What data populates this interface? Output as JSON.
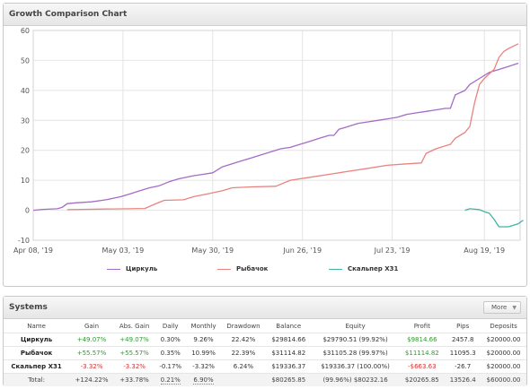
{
  "chart_panel": {
    "title": "Growth Comparison Chart"
  },
  "chart_data": {
    "type": "line",
    "x_ticks": [
      "Apr 08, '19",
      "May 03, '19",
      "May 30, '19",
      "Jun 26, '19",
      "Jul 23, '19",
      "Aug 19, '19"
    ],
    "y_ticks": [
      "60",
      "50",
      "40",
      "30",
      "20",
      "10",
      "0",
      "-10"
    ],
    "ylim": [
      -10,
      60
    ],
    "series": [
      {
        "name": "Циркуль",
        "color": "#a56bc6",
        "points": [
          [
            0,
            0
          ],
          [
            0.02,
            0.3
          ],
          [
            0.05,
            0.5
          ],
          [
            0.06,
            1.0
          ],
          [
            0.07,
            2.2
          ],
          [
            0.09,
            2.5
          ],
          [
            0.12,
            2.8
          ],
          [
            0.15,
            3.5
          ],
          [
            0.18,
            4.5
          ],
          [
            0.2,
            5.5
          ],
          [
            0.22,
            6.5
          ],
          [
            0.24,
            7.5
          ],
          [
            0.26,
            8.2
          ],
          [
            0.28,
            9.5
          ],
          [
            0.3,
            10.5
          ],
          [
            0.33,
            11.5
          ],
          [
            0.35,
            12
          ],
          [
            0.37,
            12.5
          ],
          [
            0.39,
            14.5
          ],
          [
            0.41,
            15.5
          ],
          [
            0.43,
            16.5
          ],
          [
            0.45,
            17.5
          ],
          [
            0.47,
            18.5
          ],
          [
            0.49,
            19.5
          ],
          [
            0.51,
            20.5
          ],
          [
            0.53,
            21
          ],
          [
            0.55,
            22
          ],
          [
            0.57,
            23
          ],
          [
            0.59,
            24
          ],
          [
            0.61,
            25
          ],
          [
            0.62,
            25
          ],
          [
            0.63,
            27
          ],
          [
            0.65,
            28
          ],
          [
            0.67,
            29
          ],
          [
            0.69,
            29.5
          ],
          [
            0.71,
            30
          ],
          [
            0.73,
            30.5
          ],
          [
            0.75,
            31
          ],
          [
            0.77,
            32
          ],
          [
            0.79,
            32.5
          ],
          [
            0.81,
            33
          ],
          [
            0.83,
            33.5
          ],
          [
            0.85,
            34
          ],
          [
            0.86,
            34
          ],
          [
            0.87,
            38.5
          ],
          [
            0.89,
            40
          ],
          [
            0.9,
            42
          ],
          [
            0.92,
            44
          ],
          [
            0.94,
            46
          ],
          [
            0.96,
            47
          ],
          [
            0.98,
            48
          ],
          [
            1.0,
            49.07
          ]
        ]
      },
      {
        "name": "Рыбачок",
        "color": "#e8837f",
        "points": [
          [
            0.07,
            0.2
          ],
          [
            0.1,
            0.3
          ],
          [
            0.15,
            0.4
          ],
          [
            0.2,
            0.5
          ],
          [
            0.23,
            0.6
          ],
          [
            0.25,
            2
          ],
          [
            0.27,
            3.3
          ],
          [
            0.31,
            3.5
          ],
          [
            0.33,
            4.5
          ],
          [
            0.36,
            5.5
          ],
          [
            0.39,
            6.5
          ],
          [
            0.41,
            7.5
          ],
          [
            0.45,
            7.8
          ],
          [
            0.5,
            8
          ],
          [
            0.53,
            10
          ],
          [
            0.57,
            11
          ],
          [
            0.61,
            12
          ],
          [
            0.65,
            13
          ],
          [
            0.69,
            14
          ],
          [
            0.73,
            15
          ],
          [
            0.77,
            15.5
          ],
          [
            0.8,
            15.8
          ],
          [
            0.81,
            19
          ],
          [
            0.83,
            20.5
          ],
          [
            0.86,
            22
          ],
          [
            0.87,
            24
          ],
          [
            0.89,
            26
          ],
          [
            0.9,
            28
          ],
          [
            0.91,
            36
          ],
          [
            0.92,
            42
          ],
          [
            0.93,
            44
          ],
          [
            0.95,
            47
          ],
          [
            0.96,
            51
          ],
          [
            0.97,
            53
          ],
          [
            0.98,
            54
          ],
          [
            1.0,
            55.57
          ]
        ]
      },
      {
        "name": "Скальпер Х31",
        "color": "#3fb4a8",
        "points": [
          [
            0.89,
            0
          ],
          [
            0.9,
            0.5
          ],
          [
            0.92,
            0.2
          ],
          [
            0.93,
            -0.5
          ],
          [
            0.94,
            -1
          ],
          [
            0.95,
            -3
          ],
          [
            0.96,
            -5.5
          ],
          [
            0.98,
            -5.5
          ],
          [
            1.0,
            -4.5
          ],
          [
            1.01,
            -3.3
          ]
        ]
      }
    ]
  },
  "systems": {
    "title": "Systems",
    "more_label": "More",
    "columns": [
      "Name",
      "Gain",
      "Abs. Gain",
      "Daily",
      "Monthly",
      "Drawdown",
      "Balance",
      "Equity",
      "Profit",
      "Pips",
      "Deposits"
    ],
    "rows": [
      {
        "name": "Циркуль",
        "gain": "+49.07%",
        "abs_gain": "+49.07%",
        "daily": "0.30%",
        "monthly": "9.26%",
        "drawdown": "22.42%",
        "balance": "$29814.66",
        "equity": "$29790.51 (99.92%)",
        "profit": "$9814.66",
        "pips": "2457.8",
        "deposits": "$20000.00"
      },
      {
        "name": "Рыбачок",
        "gain": "+55.57%",
        "abs_gain": "+55.57%",
        "daily": "0.35%",
        "monthly": "10.99%",
        "drawdown": "22.39%",
        "balance": "$31114.82",
        "equity": "$31105.28 (99.97%)",
        "profit": "$11114.82",
        "pips": "11095.3",
        "deposits": "$20000.00"
      },
      {
        "name": "Скальпер Х31",
        "gain": "-3.32%",
        "abs_gain": "-3.32%",
        "daily": "-0.17%",
        "monthly": "-3.32%",
        "drawdown": "6.24%",
        "balance": "$19336.37",
        "equity": "$19336.37 (100.00%)",
        "profit": "-$663.63",
        "pips": "-26.7",
        "deposits": "$20000.00"
      }
    ],
    "total": {
      "name": "Total:",
      "gain": "+124.22%",
      "abs_gain": "+33.78%",
      "daily": "0.21%",
      "monthly": "6.90%",
      "drawdown": "",
      "balance": "$80265.85",
      "equity": "(99.96%) $80232.16",
      "profit": "$20265.85",
      "pips": "13526.4",
      "deposits": "$60000.00"
    }
  }
}
